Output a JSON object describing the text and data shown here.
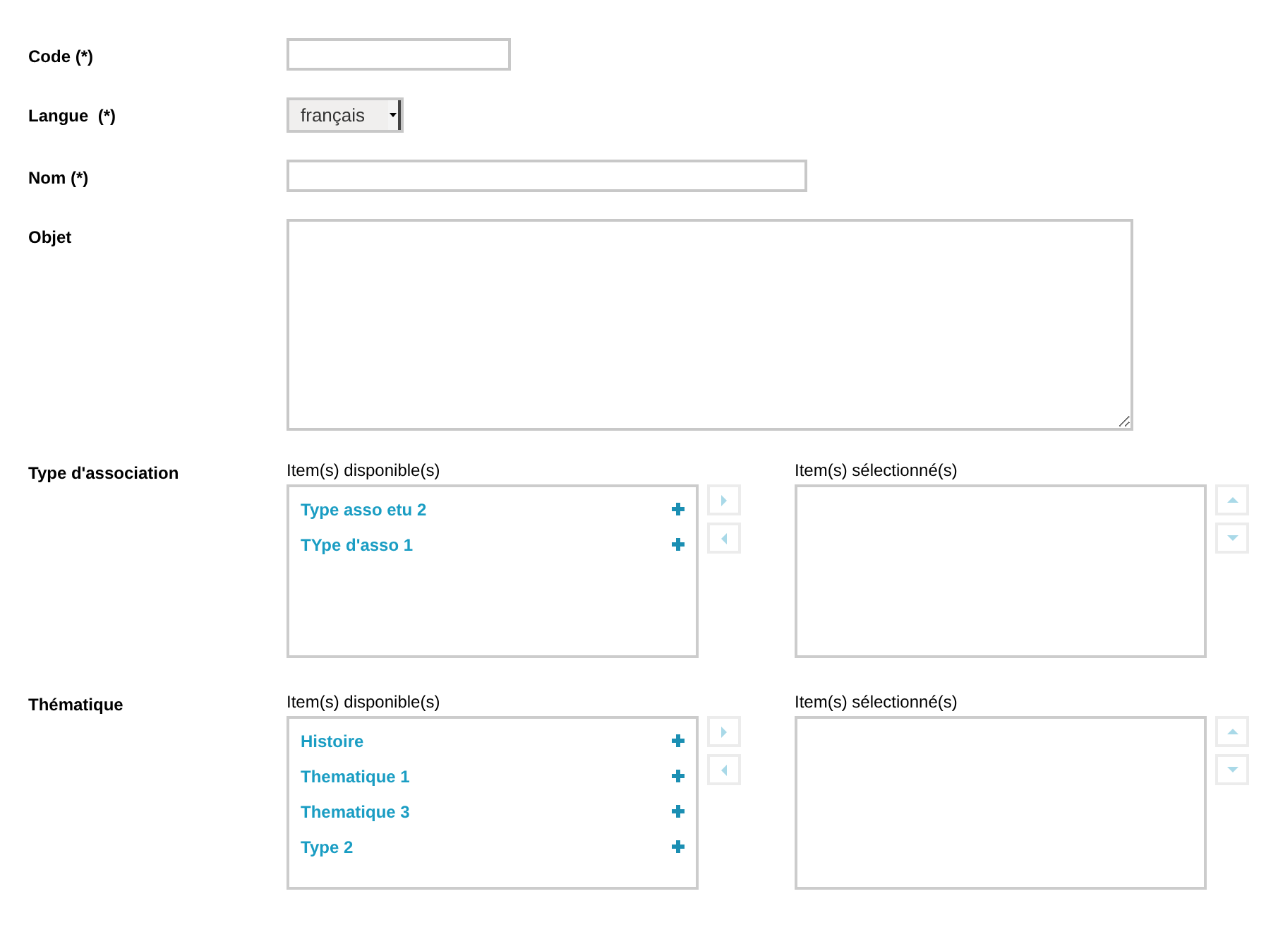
{
  "fields": [
    {
      "kind": "short_text",
      "label": "Code (*)"
    },
    {
      "kind": "select",
      "label": "Langue  (*)",
      "value": "français"
    },
    {
      "kind": "text",
      "label": "Nom (*)"
    },
    {
      "kind": "textarea",
      "label": "Objet"
    },
    {
      "kind": "picklist",
      "label": "Type d'association",
      "available_heading": "Item(s) disponible(s)",
      "selected_heading": "Item(s) sélectionné(s)",
      "available": [
        "Type asso etu 2",
        "TYpe d'asso 1"
      ]
    },
    {
      "kind": "picklist",
      "label": "Thématique",
      "available_heading": "Item(s) disponible(s)",
      "selected_heading": "Item(s) sélectionné(s)",
      "available": [
        "Histoire",
        "Thematique 1",
        "Thematique 3",
        "Type 2"
      ]
    }
  ]
}
